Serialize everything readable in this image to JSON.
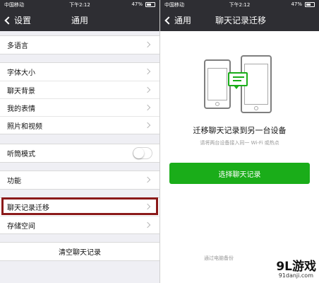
{
  "status_bar": {
    "carrier": "中国移动",
    "time": "下午2:12",
    "battery": "47%"
  },
  "left": {
    "nav": {
      "back_label": "设置",
      "title": "通用"
    },
    "rows": {
      "language": "多语言",
      "font_size": "字体大小",
      "chat_background": "聊天背景",
      "my_stickers": "我的表情",
      "photos_videos": "照片和视频",
      "earpiece_mode": "听筒模式",
      "features": "功能",
      "chat_migration": "聊天记录迁移",
      "storage": "存储空间",
      "clear_chat": "清空聊天记录"
    },
    "earpiece_mode_on": false
  },
  "right": {
    "nav": {
      "back_label": "通用",
      "title": "聊天记录迁移"
    },
    "heading": "迁移聊天记录到另一台设备",
    "subtitle": "请将两台设备接入同一 Wi-Fi 或热点",
    "button_label": "选择聊天记录",
    "bottom_link": "通过电脑备份",
    "accent_color": "#1aad19"
  },
  "watermark": {
    "logo": "9L游戏",
    "url": "91danji.com"
  }
}
